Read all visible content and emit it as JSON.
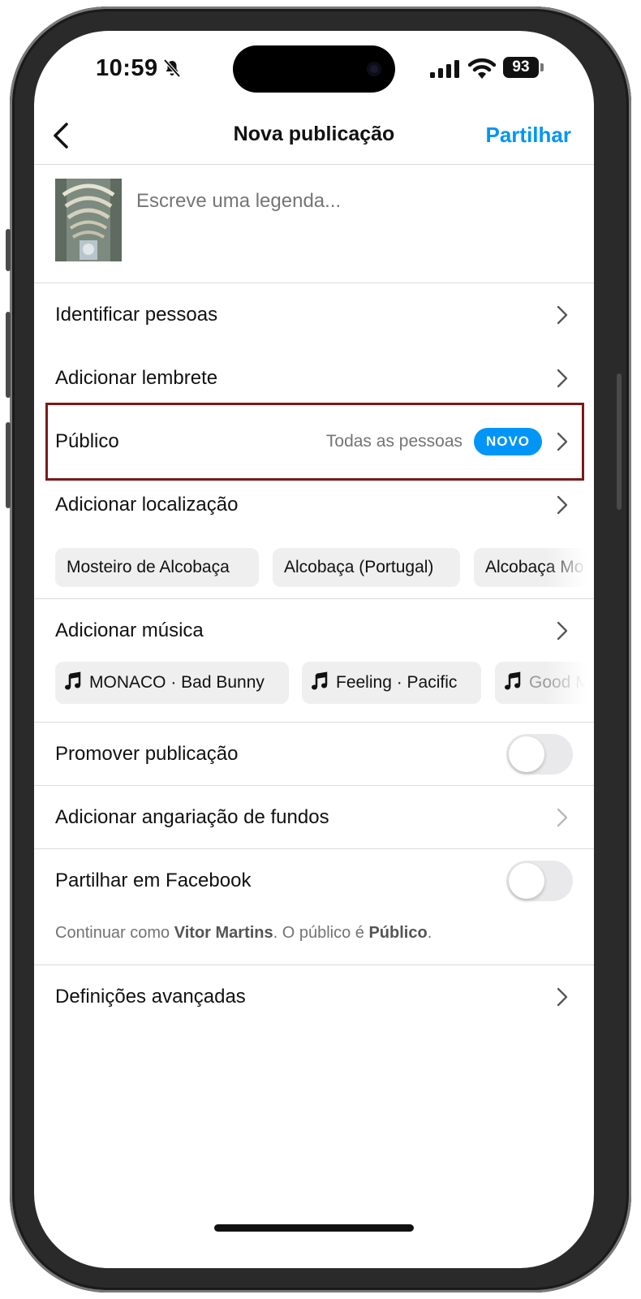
{
  "status_bar": {
    "time": "10:59",
    "battery": "93"
  },
  "header": {
    "title": "Nova publicação",
    "share_label": "Partilhar"
  },
  "caption": {
    "placeholder": "Escreve uma legenda..."
  },
  "rows": {
    "tag_people": "Identificar pessoas",
    "add_reminder": "Adicionar lembrete",
    "audience": {
      "label": "Público",
      "value": "Todas as pessoas",
      "badge": "NOVO"
    },
    "add_location": "Adicionar localização",
    "add_music": "Adicionar música",
    "promote": "Promover publicação",
    "fundraiser": "Adicionar angariação de fundos",
    "share_facebook": "Partilhar em Facebook",
    "advanced": "Definições avançadas"
  },
  "location_suggestions": [
    "Mosteiro de Alcobaça",
    "Alcobaça (Portugal)",
    "Alcobaça Mo"
  ],
  "music_suggestions": [
    "MONACO · Bad Bunny",
    "Feeling · Pacific",
    "Good M"
  ],
  "facebook_note": {
    "prefix": "Continuar como ",
    "user": "Vitor Martins",
    "middle": ". O público é ",
    "audience": "Público",
    "suffix": "."
  },
  "toggles": {
    "promote_on": false,
    "facebook_on": false
  },
  "colors": {
    "accent": "#0095f6",
    "highlight_border": "#7a1a1a",
    "divider": "#dbdbdb"
  },
  "icons": {
    "back": "chevron-left-icon",
    "chevron": "chevron-right-icon",
    "music_note": "music-note-icon",
    "bell_muted": "bell-slash-icon",
    "signal": "cellular-signal-icon",
    "wifi": "wifi-icon"
  }
}
